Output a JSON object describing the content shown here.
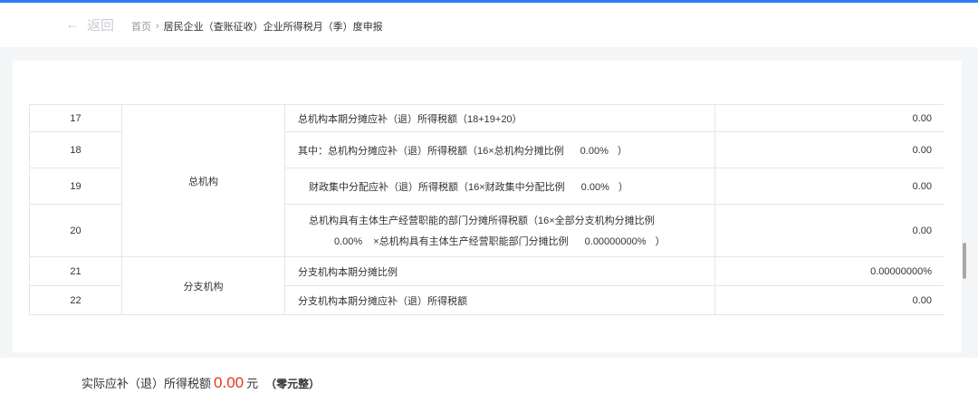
{
  "header": {
    "back_label": "返回",
    "back_arrow": "←",
    "breadcrumb": {
      "home": "首页",
      "separator": "›",
      "current": "居民企业（查账征收）企业所得税月（季）度申报"
    }
  },
  "table": {
    "rows": [
      {
        "no": "17",
        "group": "总机构",
        "item": "总机构本期分摊应补（退）所得税额（18+19+20）",
        "value": "0.00"
      },
      {
        "no": "18",
        "item_prefix": "其中：总机构分摊应补（退）所得税额（16×总机构分摊比例",
        "pct": "0.00%",
        "item_suffix": "）",
        "value": "0.00"
      },
      {
        "no": "19",
        "item_prefix": "财政集中分配应补（退）所得税额（16×财政集中分配比例",
        "pct": "0.00%",
        "item_suffix": "）",
        "value": "0.00"
      },
      {
        "no": "20",
        "item_line1": "总机构具有主体生产经营职能的部门分摊所得税额（16×全部分支机构分摊比例",
        "pct1": "0.00%",
        "item_mid": "×总机构具有主体生产经营职能部门分摊比例",
        "pct2": "0.00000000%",
        "item_suffix": "）",
        "value": "0.00"
      },
      {
        "no": "21",
        "group": "分支机构",
        "item": "分支机构本期分摊比例",
        "value": "0.00000000%"
      },
      {
        "no": "22",
        "item": "分支机构本期分摊应补（退）所得税额",
        "value": "0.00"
      }
    ]
  },
  "footer": {
    "label": "实际应补（退）所得税额",
    "amount": "0.00",
    "unit": "元",
    "uppercase": "（零元整）"
  },
  "colors": {
    "accent": "#2f7df6",
    "amount": "#e8341c"
  }
}
